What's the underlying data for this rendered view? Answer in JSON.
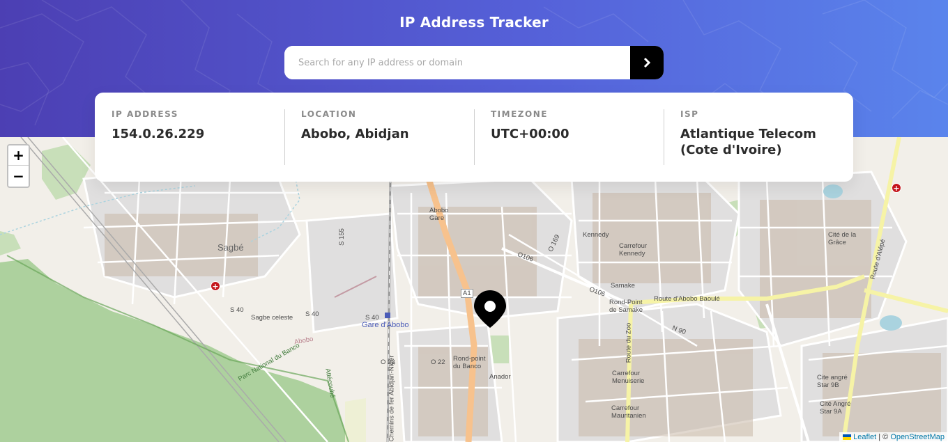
{
  "app": {
    "title": "IP Address Tracker"
  },
  "search": {
    "placeholder": "Search for any IP address or domain",
    "value": ""
  },
  "info": {
    "ip_label": "IP ADDRESS",
    "ip_value": "154.0.26.229",
    "location_label": "LOCATION",
    "location_value": "Abobo, Abidjan",
    "timezone_label": "TIMEZONE",
    "timezone_value": "UTC+00:00",
    "isp_label": "ISP",
    "isp_value": "Atlantique Telecom (Cote d'Ivoire)"
  },
  "map": {
    "zoom_in": "+",
    "zoom_out": "−",
    "attribution_leaflet": "Leaflet",
    "attribution_sep": " | © ",
    "attribution_osm": "OpenStreetMap",
    "marker_icon": "location-pin-icon",
    "labels": {
      "sagbe": "Sagbé",
      "sagbe_celeste": "Sagbe celeste",
      "s40a": "S 40",
      "s40b": "S 40",
      "s40c": "S 40",
      "s155": "S 155",
      "gare_abobo": "Gare d'Abobo",
      "abobo_gare": "Abobo\nGare",
      "kennedy": "Kennedy",
      "carrefour_kennedy": "Carrefour\nKennedy",
      "samake": "Samake",
      "rond_point_samake": "Rond-Point\nde Samake",
      "route_abobo_baoule": "Route d'Abobo Baoulé",
      "route_zoo": "Route du Zoo",
      "n90": "N 90",
      "o106a": "O106",
      "o106b": "O106",
      "o169": "O 169",
      "o22a": "O 22",
      "o22b": "O 22",
      "a1": "A1",
      "rond_point_banco": "Rond-point\ndu Banco",
      "anador": "Anador",
      "carrefour_menuiserie": "Carrefour\nMenuiserie",
      "carrefour_mauritanien": "Carrefour\nMauritanien",
      "parc_banco": "Parc National du Banco",
      "attecoube": "Attécoubé",
      "abobo_road": "Abobo",
      "chemins_fer": "Chemins de fer Abidjan-Niger",
      "cite_grace": "Cité de la\nGrâce",
      "route_alepe": "Route d'Alépé",
      "cite_angre_9b": "Cite angré\nStar 9B",
      "cite_angre_9a": "Cité Angré\nStar 9A"
    }
  },
  "colors": {
    "header_start": "#4c3fb3",
    "header_end": "#5a84ec",
    "button_bg": "#000000",
    "marker": "#000000"
  }
}
